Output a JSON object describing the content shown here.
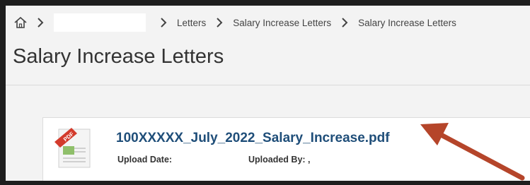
{
  "breadcrumb": {
    "items": [
      "Letters",
      "Salary Increase Letters",
      "Salary Increase Letters"
    ]
  },
  "page": {
    "title": "Salary Increase Letters"
  },
  "file": {
    "name": "100XXXXX_July_2022_Salary_Increase.pdf",
    "upload_date_label": "Upload Date:",
    "uploaded_by_label": "Uploaded By: ,",
    "thumbnail_badge": "PDF"
  },
  "colors": {
    "link": "#1f4e79",
    "arrow": "#b5452a"
  },
  "icons": [
    "home-icon",
    "chevron-right-icon",
    "pdf-file-icon",
    "annotation-arrow"
  ]
}
